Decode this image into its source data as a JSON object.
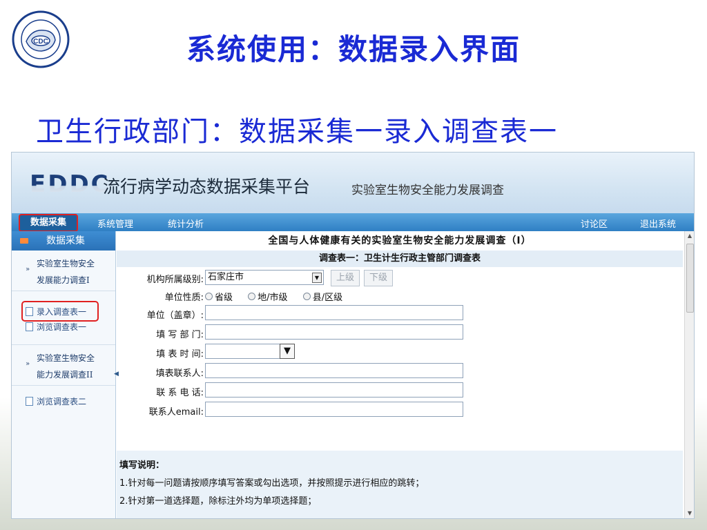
{
  "slide": {
    "title": "系统使用：数据录入界面",
    "subtitle": "卫生行政部门：数据采集一录入调查表一",
    "logo_text": "CDC"
  },
  "app": {
    "brand": "EDDC",
    "platform_name": "流行病学动态数据采集平台",
    "survey_name": "实验室生物安全能力发展调查",
    "nav": {
      "items": [
        "数据采集",
        "系统管理",
        "统计分析"
      ],
      "right_items": [
        "讨论区",
        "退出系统"
      ],
      "active": "数据采集"
    },
    "sidebar": {
      "header": "数据采集",
      "group1": {
        "line1": "实验室生物安全",
        "line2": "发展能力调查I"
      },
      "link1": "录入调查表一",
      "link2": "浏览调查表一",
      "group2": {
        "line1": "实验室生物安全",
        "line2": "能力发展调查II"
      },
      "link3": "浏览调查表二"
    },
    "content": {
      "title": "全国与人体健康有关的实验室生物安全能力发展调查（I）",
      "subtitle": "调查表一：卫生计生行政主管部门调查表",
      "fields": {
        "org_level_label": "机构所属级别:",
        "org_level_value": "石家庄市",
        "up_button": "上级",
        "down_button": "下级",
        "unit_nature_label": "单位性质:",
        "radio_options": [
          "省级",
          "地/市级",
          "县/区级"
        ],
        "unit_label": "单位（盖章）:",
        "dept_label": "填 写 部 门:",
        "date_label": "填 表 时 间:",
        "contact_label": "填表联系人:",
        "phone_label": "联 系 电 话:",
        "email_label": "联系人email:"
      },
      "notes": {
        "heading": "填写说明：",
        "line1": "1.针对每一问题请按顺序填写答案或勾出选项，并按照提示进行相应的跳转；",
        "line2": "2.针对第一道选择题，除标注外均为单项选择题；"
      }
    }
  },
  "colors": {
    "title_blue": "#1a2ad4",
    "nav_blue": "#2f7fc4",
    "highlight_red": "#e02020"
  }
}
